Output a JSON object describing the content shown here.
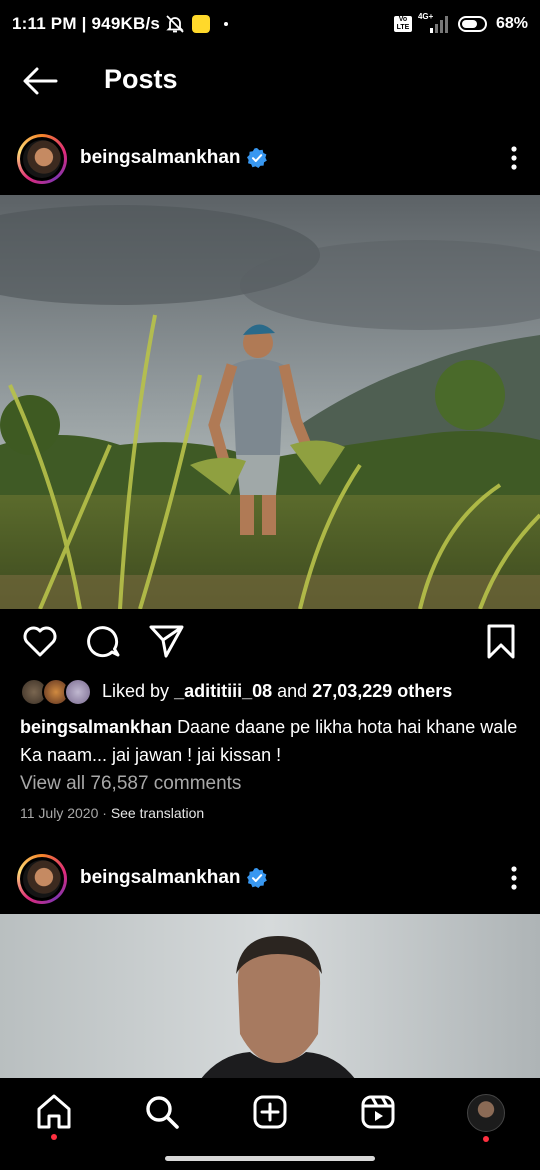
{
  "status_bar": {
    "time": "1:11 PM",
    "speed": "949KB/s",
    "network": "4G+",
    "battery": "68%"
  },
  "header": {
    "title": "Posts"
  },
  "posts": [
    {
      "username": "beingsalmankhan",
      "verified": true,
      "liked_by_user": "_adititiii_08",
      "likes_connector": "and",
      "likes_others": "27,03,229 others",
      "liked_by_label": "Liked by",
      "caption": "Daane daane pe likha hota hai khane wale Ka naam... jai jawan ! jai kissan !",
      "comments_link": "View all 76,587 comments",
      "date": "11 July 2020",
      "translation_link": "See translation"
    },
    {
      "username": "beingsalmankhan",
      "verified": true
    }
  ],
  "colors": {
    "background": "#000000",
    "verified_blue": "#3897f0",
    "notification_red": "#ff3040",
    "muted_text": "#a8a8a8"
  },
  "icons": [
    "back-arrow-icon",
    "verified-badge-icon",
    "more-options-icon",
    "heart-icon",
    "comment-icon",
    "share-icon",
    "bookmark-icon",
    "home-icon",
    "search-icon",
    "create-icon",
    "reels-icon"
  ]
}
